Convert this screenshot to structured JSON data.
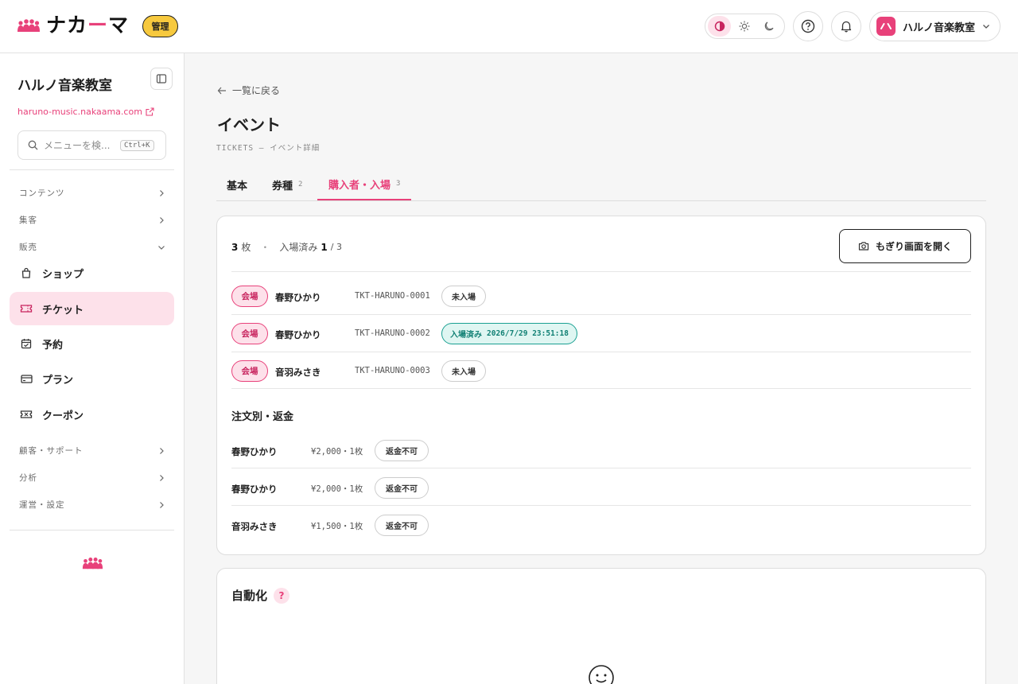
{
  "header": {
    "brand_main": "ナカ",
    "brand_accent": "ー",
    "brand_end": "マ",
    "admin_badge": "管理",
    "account_name": "ハルノ音楽教室",
    "colors": {
      "accent": "#e8417a",
      "admin_badge": "#f7c93e",
      "success": "#1aa092"
    },
    "icons": [
      "contrast-icon",
      "sun-icon",
      "moon-icon",
      "help-icon",
      "bell-icon",
      "chevron-down-icon"
    ]
  },
  "sidebar": {
    "title": "ハルノ音楽教室",
    "url": "haruno-music.nakaama.com",
    "search_placeholder": "メニューを検...",
    "search_shortcut": "Ctrl+K",
    "groups": {
      "content": "コンテンツ",
      "marketing": "集客",
      "sales": "販売",
      "customer": "顧客・サポート",
      "analytics": "分析",
      "settings": "運営・設定"
    },
    "items": {
      "shop": "ショップ",
      "ticket": "チケット",
      "booking": "予約",
      "plan": "プラン",
      "coupon": "クーポン"
    }
  },
  "main": {
    "back_label": "一覧に戻る",
    "title": "イベント",
    "subtitle": "TICKETS — イベント詳細",
    "tabs": [
      {
        "label": "基本",
        "count": ""
      },
      {
        "label": "券種",
        "count": "2"
      },
      {
        "label": "購入者・入場",
        "count": "3"
      }
    ],
    "summary": {
      "tickets_count": "3",
      "tickets_unit": "枚",
      "separator": "・",
      "entered_label": "入場済み",
      "entered_count": "1",
      "total": "/ 3"
    },
    "gate_button": "もぎり画面を開く",
    "tickets": [
      {
        "tag": "会場",
        "name": "春野ひかり",
        "id": "TKT-HARUNO-0001",
        "status": "未入場",
        "entered": false,
        "timestamp": ""
      },
      {
        "tag": "会場",
        "name": "春野ひかり",
        "id": "TKT-HARUNO-0002",
        "status": "入場済み",
        "entered": true,
        "timestamp": "2026/7/29 23:51:18"
      },
      {
        "tag": "会場",
        "name": "音羽みさき",
        "id": "TKT-HARUNO-0003",
        "status": "未入場",
        "entered": false,
        "timestamp": ""
      }
    ],
    "orders_title": "注文別・返金",
    "orders": [
      {
        "name": "春野ひかり",
        "amount": "¥2,000・1枚",
        "refund": "返金不可"
      },
      {
        "name": "春野ひかり",
        "amount": "¥2,000・1枚",
        "refund": "返金不可"
      },
      {
        "name": "音羽みさき",
        "amount": "¥1,500・1枚",
        "refund": "返金不可"
      }
    ],
    "automation_title": "自動化",
    "automation_help": "?"
  }
}
